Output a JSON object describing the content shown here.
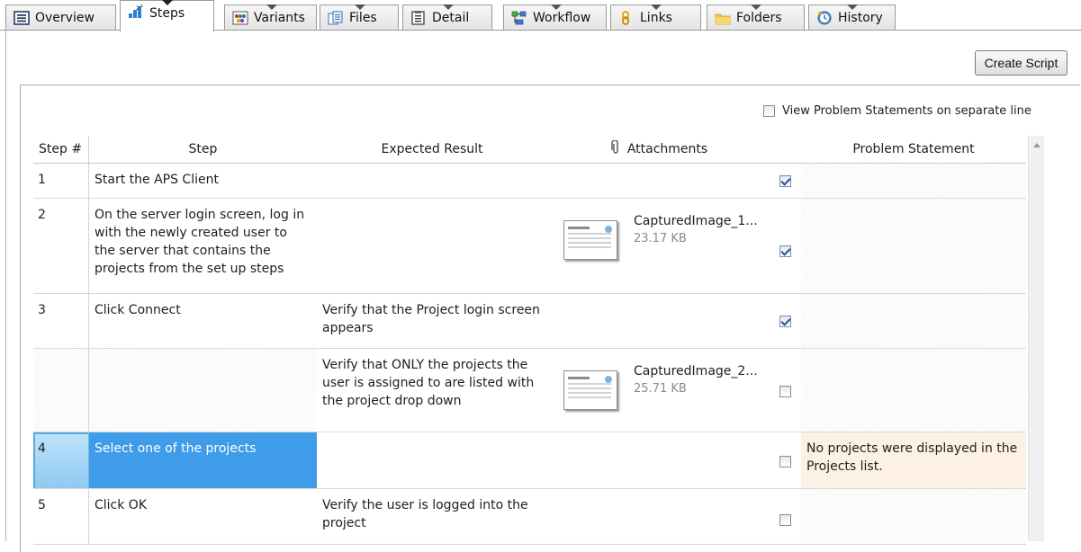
{
  "tabs": [
    {
      "label": "Overview",
      "icon": "overview-icon"
    },
    {
      "label": "Steps",
      "icon": "steps-icon",
      "active": true
    },
    {
      "label": "Variants",
      "icon": "variants-icon"
    },
    {
      "label": "Files",
      "icon": "files-icon"
    },
    {
      "label": "Detail",
      "icon": "detail-icon"
    },
    {
      "label": "Workflow",
      "icon": "workflow-icon"
    },
    {
      "label": "Links",
      "icon": "links-icon"
    },
    {
      "label": "Folders",
      "icon": "folder-icon"
    },
    {
      "label": "History",
      "icon": "history-icon"
    }
  ],
  "toolbar": {
    "create_script_label": "Create Script"
  },
  "options": {
    "view_problem_statements_label": "View Problem Statements on separate line",
    "view_problem_statements_checked": false
  },
  "grid": {
    "columns": {
      "step_num": "Step #",
      "step": "Step",
      "expected": "Expected Result",
      "attachments": "Attachments",
      "problem": "Problem Statement"
    },
    "rows": [
      {
        "num": "1",
        "step": "Start the APS Client",
        "expected": "",
        "attachment": null,
        "passed": true,
        "problem": ""
      },
      {
        "num": "2",
        "step": "On the server login screen, log in with the newly created user to the server that contains the projects from the set up steps",
        "expected": "",
        "attachment": {
          "name": "CapturedImage_1...",
          "size": "23.17 KB"
        },
        "passed": true,
        "problem": ""
      },
      {
        "num": "3",
        "step": "Click Connect",
        "expected": "Verify that the Project login screen appears",
        "attachment": null,
        "passed": true,
        "problem": ""
      },
      {
        "num": "",
        "step": "",
        "expected": "Verify that ONLY the projects the user is assigned to are listed with the project drop down",
        "attachment": {
          "name": "CapturedImage_2...",
          "size": "25.71 KB"
        },
        "passed": false,
        "problem": ""
      },
      {
        "num": "4",
        "step": "Select one of the projects",
        "expected": "",
        "attachment": null,
        "passed": false,
        "problem": "No projects were displayed in the Projects list.",
        "selected": true
      },
      {
        "num": "5",
        "step": "Click OK",
        "expected": "Verify the user is logged into the project",
        "attachment": null,
        "passed": false,
        "problem": ""
      }
    ]
  },
  "colors": {
    "selection": "#3e9ce8",
    "problem_bg": "#fdf1e6",
    "header_border": "#9a9a9a"
  }
}
